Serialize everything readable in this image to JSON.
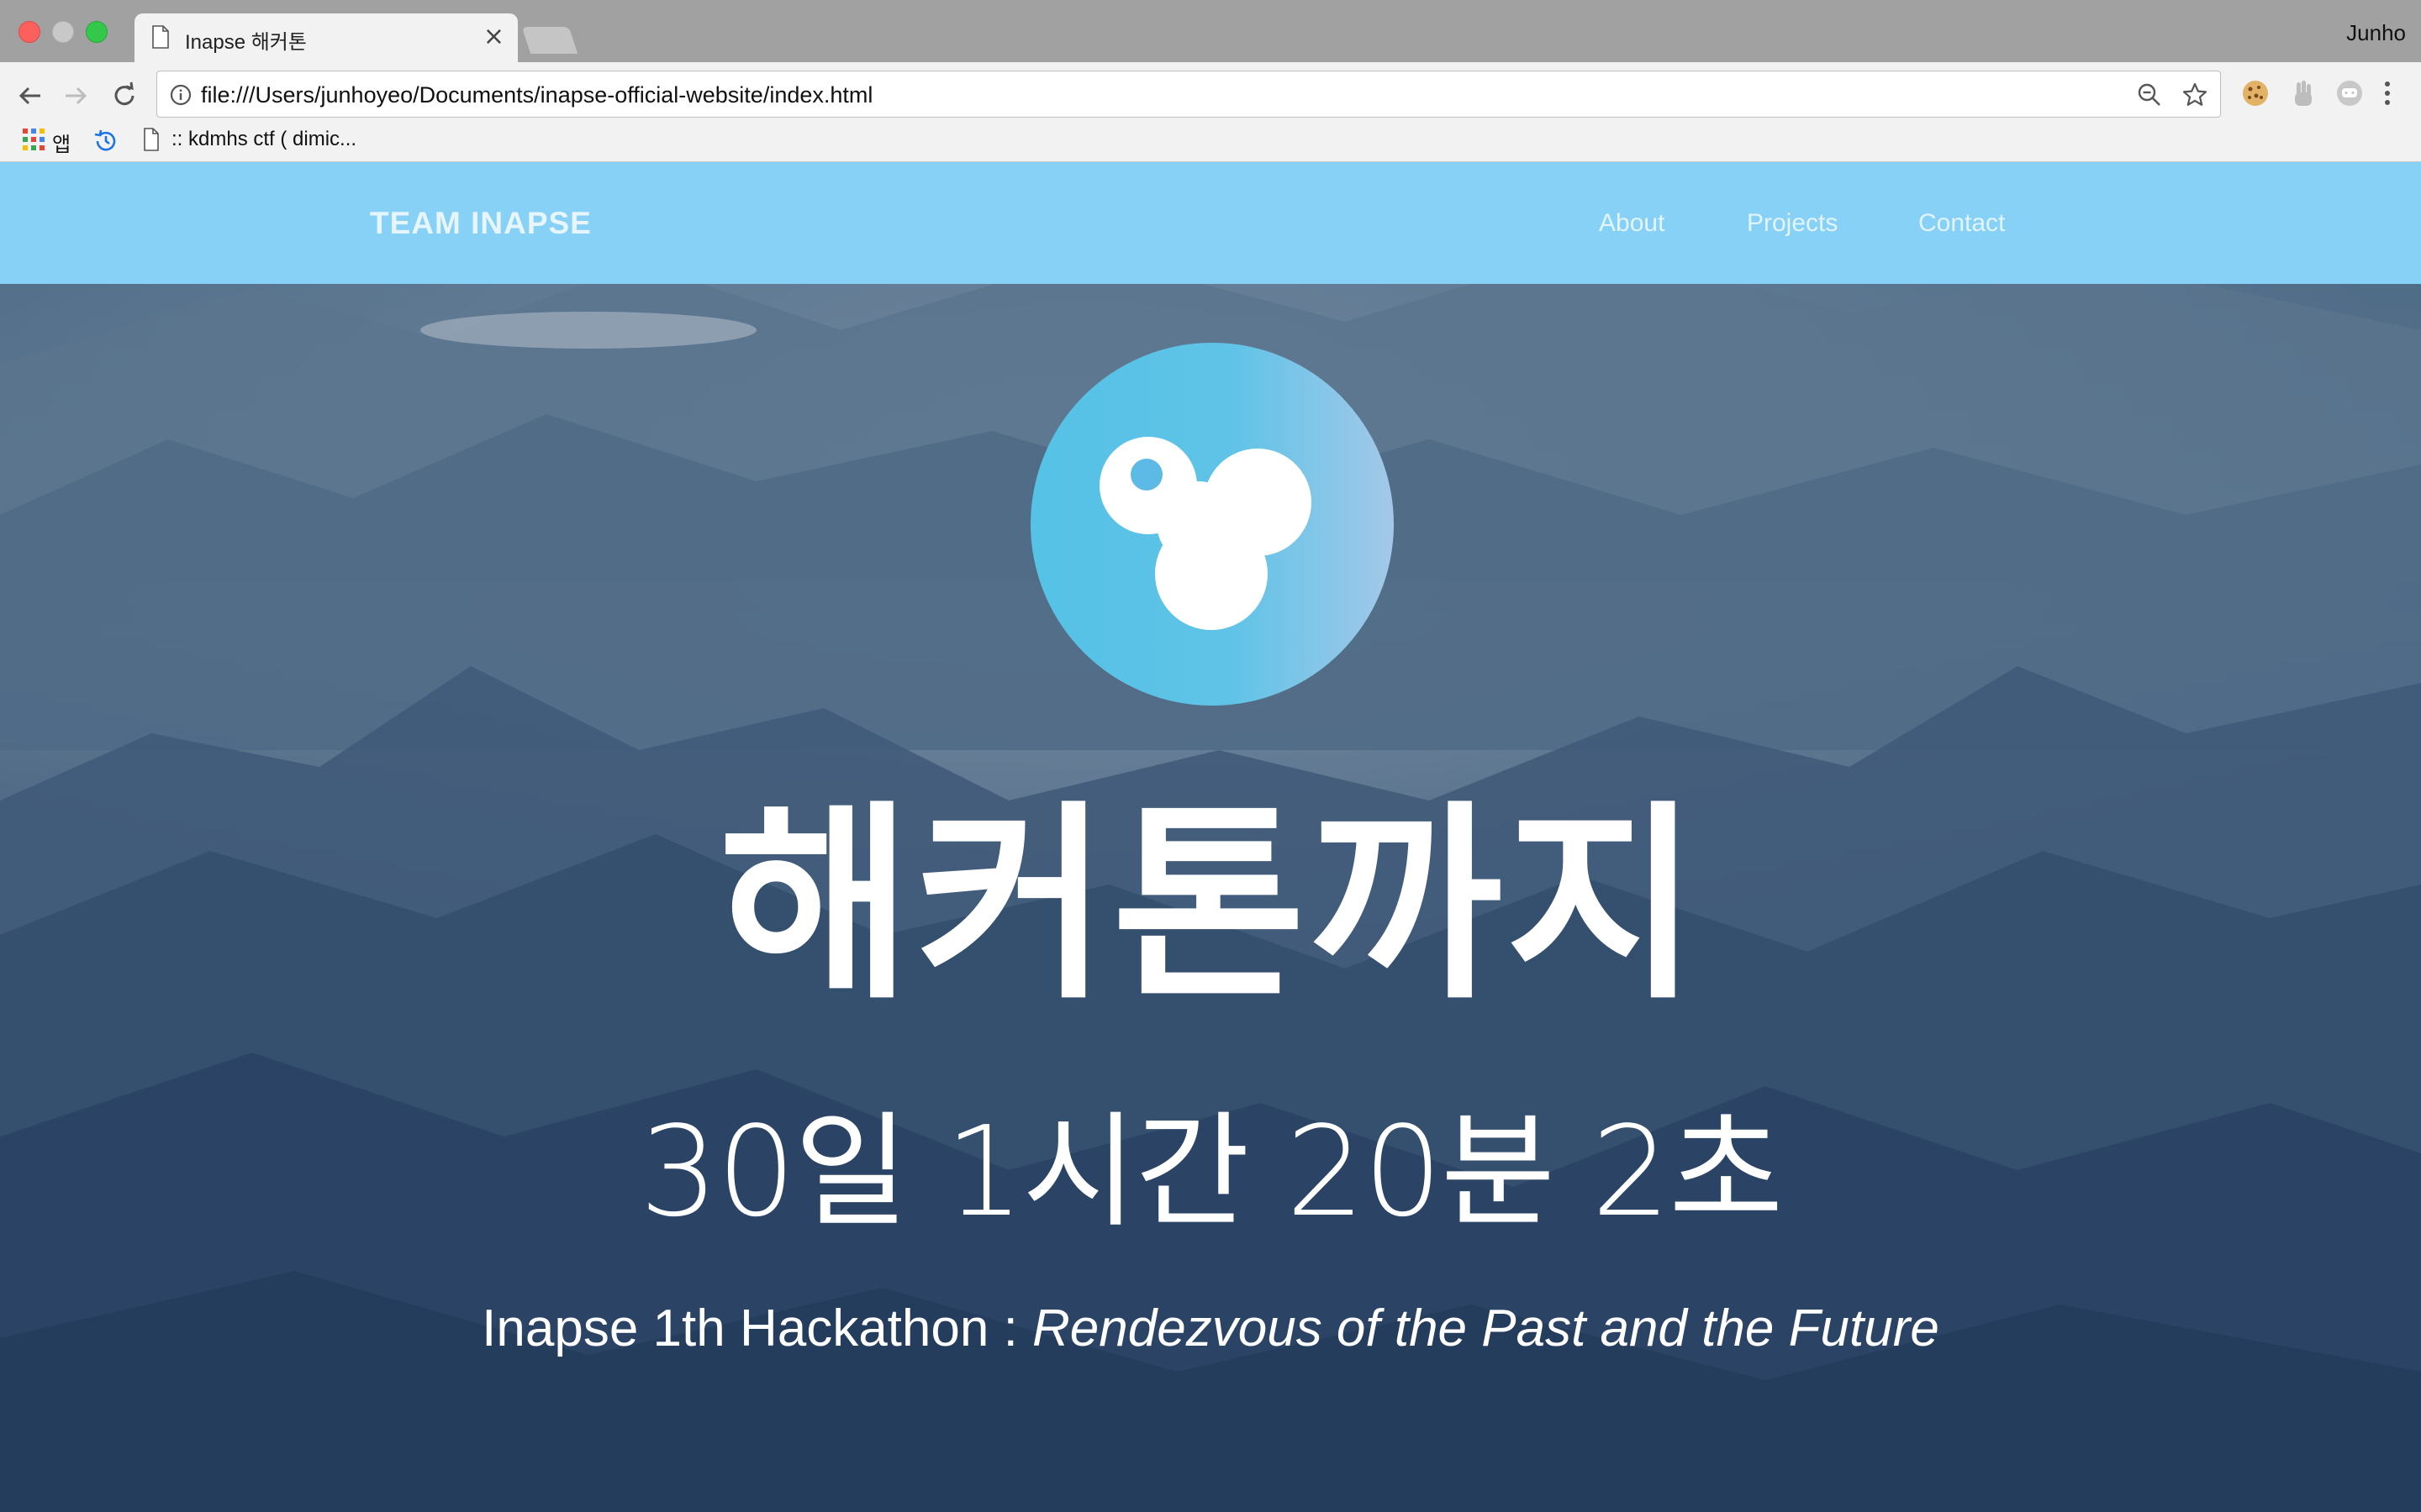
{
  "window": {
    "tab_title": "Inapse 해커톤",
    "tab_close": "×",
    "profile_name": "Junho"
  },
  "toolbar": {
    "url": "file:///Users/junhoyeo/Documents/inapse-official-website/index.html"
  },
  "bookmarks": {
    "apps_label": "앱",
    "items": [
      {
        "label": ":: kdmhs ctf ( dimic..."
      }
    ]
  },
  "site": {
    "brand": "TEAM INAPSE",
    "nav": [
      {
        "label": "About"
      },
      {
        "label": "Projects"
      },
      {
        "label": "Contact"
      }
    ],
    "headline": "해커톤까지",
    "countdown": "30일 1시간 20분 2초",
    "subtitle_plain": "Inapse 1th Hackathon : ",
    "subtitle_italic": "Rendezvous of the Past and the Future"
  },
  "colors": {
    "nav_bar": "#87d1f6",
    "logo_gradient_start": "#55c2e6",
    "logo_gradient_end": "#a3c8e8",
    "hero_overlay": "#2a3f5e"
  },
  "icons": {
    "back": "arrow-left-icon",
    "forward": "arrow-right-icon",
    "reload": "reload-icon",
    "info": "info-icon",
    "zoom": "zoom-out-icon",
    "star": "star-icon",
    "cookie_ext": "cookie-icon",
    "ext2": "hand-icon",
    "ext3": "chat-icon",
    "menu": "kebab-menu-icon"
  }
}
